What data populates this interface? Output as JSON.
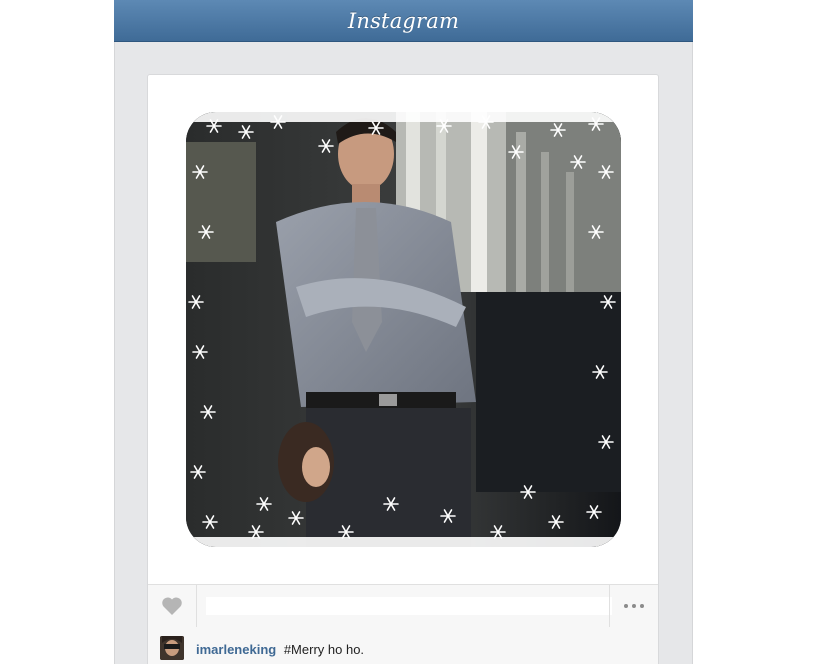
{
  "header": {
    "logo": "Instagram"
  },
  "post": {
    "photo": {
      "description_icon": "photo-with-snowflake-frame"
    },
    "actions": {
      "like_icon": "heart-icon",
      "comment_placeholder": "",
      "more_icon": "ellipsis-icon"
    },
    "caption": {
      "username": "imarleneking",
      "text": "#Merry ho ho."
    }
  },
  "colors": {
    "header": "#4a76a2",
    "background": "#e6e7e9",
    "username": "#3f6994"
  }
}
